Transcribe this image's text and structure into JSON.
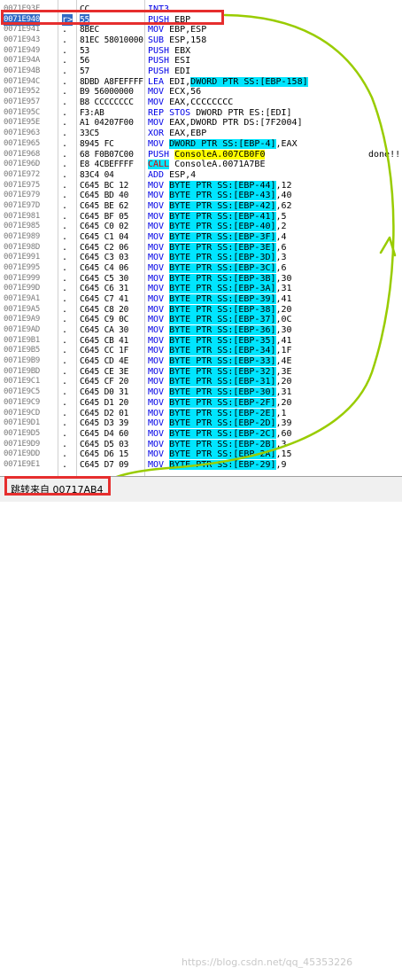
{
  "disassembly": {
    "rows": [
      {
        "addr": "0071E93F",
        "mark": "",
        "hex": "CC",
        "mnem": "INT3"
      },
      {
        "addr": "0071E940",
        "mark": "r>",
        "hex": "55",
        "mnem": "PUSH EBP"
      },
      {
        "addr": "0071E941",
        "mark": ".",
        "hex": "8BEC",
        "mnem": "MOV EBP,ESP"
      },
      {
        "addr": "0071E943",
        "mark": ".",
        "hex": "81EC 58010000",
        "mnem": "SUB ESP,158"
      },
      {
        "addr": "0071E949",
        "mark": ".",
        "hex": "53",
        "mnem": "PUSH EBX"
      },
      {
        "addr": "0071E94A",
        "mark": ".",
        "hex": "56",
        "mnem": "PUSH ESI"
      },
      {
        "addr": "0071E94B",
        "mark": ".",
        "hex": "57",
        "mnem": "PUSH EDI"
      },
      {
        "addr": "0071E94C",
        "mark": ".",
        "hex": "8DBD A8FEFFFF",
        "mnem": "LEA EDI,DWORD PTR SS:[EBP-158]"
      },
      {
        "addr": "0071E952",
        "mark": ".",
        "hex": "B9 56000000",
        "mnem": "MOV ECX,56"
      },
      {
        "addr": "0071E957",
        "mark": ".",
        "hex": "B8 CCCCCCCC",
        "mnem": "MOV EAX,CCCCCCCC"
      },
      {
        "addr": "0071E95C",
        "mark": ".",
        "hex": "F3:AB",
        "mnem": "REP STOS DWORD PTR ES:[EDI]"
      },
      {
        "addr": "0071E95E",
        "mark": ".",
        "hex": "A1 04207F00",
        "mnem": "MOV EAX,DWORD PTR DS:[7F2004]"
      },
      {
        "addr": "0071E963",
        "mark": ".",
        "hex": "33C5",
        "mnem": "XOR EAX,EBP"
      },
      {
        "addr": "0071E965",
        "mark": ".",
        "hex": "8945 FC",
        "mnem": "MOV DWORD PTR SS:[EBP-4],EAX"
      },
      {
        "addr": "0071E968",
        "mark": ".",
        "hex": "68 F0B07C00",
        "mnem": "PUSH ConsoleA.007CB0F0",
        "comment": "done!!!"
      },
      {
        "addr": "0071E96D",
        "mark": ".",
        "hex": "E8 4CBEFFFF",
        "mnem": "CALL ConsoleA.0071A7BE"
      },
      {
        "addr": "0071E972",
        "mark": ".",
        "hex": "83C4 04",
        "mnem": "ADD ESP,4"
      },
      {
        "addr": "0071E975",
        "mark": ".",
        "hex": "C645 BC 12",
        "mnem": "MOV BYTE PTR SS:[EBP-44],12"
      },
      {
        "addr": "0071E979",
        "mark": ".",
        "hex": "C645 BD 40",
        "mnem": "MOV BYTE PTR SS:[EBP-43],40"
      },
      {
        "addr": "0071E97D",
        "mark": ".",
        "hex": "C645 BE 62",
        "mnem": "MOV BYTE PTR SS:[EBP-42],62"
      },
      {
        "addr": "0071E981",
        "mark": ".",
        "hex": "C645 BF 05",
        "mnem": "MOV BYTE PTR SS:[EBP-41],5"
      },
      {
        "addr": "0071E985",
        "mark": ".",
        "hex": "C645 C0 02",
        "mnem": "MOV BYTE PTR SS:[EBP-40],2"
      },
      {
        "addr": "0071E989",
        "mark": ".",
        "hex": "C645 C1 04",
        "mnem": "MOV BYTE PTR SS:[EBP-3F],4"
      },
      {
        "addr": "0071E98D",
        "mark": ".",
        "hex": "C645 C2 06",
        "mnem": "MOV BYTE PTR SS:[EBP-3E],6"
      },
      {
        "addr": "0071E991",
        "mark": ".",
        "hex": "C645 C3 03",
        "mnem": "MOV BYTE PTR SS:[EBP-3D],3"
      },
      {
        "addr": "0071E995",
        "mark": ".",
        "hex": "C645 C4 06",
        "mnem": "MOV BYTE PTR SS:[EBP-3C],6"
      },
      {
        "addr": "0071E999",
        "mark": ".",
        "hex": "C645 C5 30",
        "mnem": "MOV BYTE PTR SS:[EBP-3B],30"
      },
      {
        "addr": "0071E99D",
        "mark": ".",
        "hex": "C645 C6 31",
        "mnem": "MOV BYTE PTR SS:[EBP-3A],31"
      },
      {
        "addr": "0071E9A1",
        "mark": ".",
        "hex": "C645 C7 41",
        "mnem": "MOV BYTE PTR SS:[EBP-39],41"
      },
      {
        "addr": "0071E9A5",
        "mark": ".",
        "hex": "C645 C8 20",
        "mnem": "MOV BYTE PTR SS:[EBP-38],20"
      },
      {
        "addr": "0071E9A9",
        "mark": ".",
        "hex": "C645 C9 0C",
        "mnem": "MOV BYTE PTR SS:[EBP-37],0C"
      },
      {
        "addr": "0071E9AD",
        "mark": ".",
        "hex": "C645 CA 30",
        "mnem": "MOV BYTE PTR SS:[EBP-36],30"
      },
      {
        "addr": "0071E9B1",
        "mark": ".",
        "hex": "C645 CB 41",
        "mnem": "MOV BYTE PTR SS:[EBP-35],41"
      },
      {
        "addr": "0071E9B5",
        "mark": ".",
        "hex": "C645 CC 1F",
        "mnem": "MOV BYTE PTR SS:[EBP-34],1F"
      },
      {
        "addr": "0071E9B9",
        "mark": ".",
        "hex": "C645 CD 4E",
        "mnem": "MOV BYTE PTR SS:[EBP-33],4E"
      },
      {
        "addr": "0071E9BD",
        "mark": ".",
        "hex": "C645 CE 3E",
        "mnem": "MOV BYTE PTR SS:[EBP-32],3E"
      },
      {
        "addr": "0071E9C1",
        "mark": ".",
        "hex": "C645 CF 20",
        "mnem": "MOV BYTE PTR SS:[EBP-31],20"
      },
      {
        "addr": "0071E9C5",
        "mark": ".",
        "hex": "C645 D0 31",
        "mnem": "MOV BYTE PTR SS:[EBP-30],31"
      },
      {
        "addr": "0071E9C9",
        "mark": ".",
        "hex": "C645 D1 20",
        "mnem": "MOV BYTE PTR SS:[EBP-2F],20"
      },
      {
        "addr": "0071E9CD",
        "mark": ".",
        "hex": "C645 D2 01",
        "mnem": "MOV BYTE PTR SS:[EBP-2E],1"
      },
      {
        "addr": "0071E9D1",
        "mark": ".",
        "hex": "C645 D3 39",
        "mnem": "MOV BYTE PTR SS:[EBP-2D],39"
      },
      {
        "addr": "0071E9D5",
        "mark": ".",
        "hex": "C645 D4 60",
        "mnem": "MOV BYTE PTR SS:[EBP-2C],60"
      },
      {
        "addr": "0071E9D9",
        "mark": ".",
        "hex": "C645 D5 03",
        "mnem": "MOV BYTE PTR SS:[EBP-2B],3"
      },
      {
        "addr": "0071E9DD",
        "mark": ".",
        "hex": "C645 D6 15",
        "mnem": "MOV BYTE PTR SS:[EBP-2A],15"
      },
      {
        "addr": "0071E9E1",
        "mark": ".",
        "hex": "C645 D7 09",
        "mnem": "MOV BYTE PTR SS:[EBP-29],9"
      }
    ]
  },
  "status_bar": {
    "text": "跳转来自 00717AB4",
    "watermark": "https://blog.csdn.net/qq_45353226"
  },
  "colors": {
    "operand_highlight": "#00e5ff",
    "symbol_highlight": "#ffff00",
    "annotation_red": "#e62e2e",
    "annotation_green": "#99cc00"
  }
}
